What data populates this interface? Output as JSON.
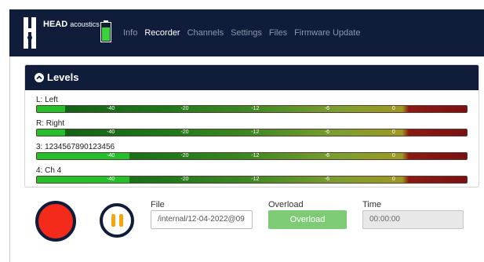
{
  "app": {
    "logo_text": "HEAD",
    "logo_sub": "acoustics",
    "battery_level": 0.85,
    "colors": {
      "navbar": "#0f1c3a",
      "record": "#f42a1a",
      "pause": "#f6a50b",
      "overload": "#7ecb75"
    }
  },
  "nav": {
    "items": [
      "Info",
      "Recorder",
      "Channels",
      "Settings",
      "Files",
      "Firmware Update"
    ],
    "active": "Recorder"
  },
  "levels": {
    "title": "Levels",
    "ticks": [
      "-40",
      "-20",
      "-12",
      "-6",
      "0"
    ],
    "channels": [
      {
        "label": "L: Left",
        "level": 0.065
      },
      {
        "label": "R: Right",
        "level": 0.065
      },
      {
        "label": "3: 1234567890123456",
        "level": 0.215
      },
      {
        "label": "4: Ch 4",
        "level": 0.215
      }
    ]
  },
  "controls": {
    "file_label": "File",
    "file_value": "/internal/12-04-2022@09",
    "overload_label": "Overload",
    "overload_button": "Overload",
    "time_label": "Time",
    "time_value": "00:00:00"
  }
}
